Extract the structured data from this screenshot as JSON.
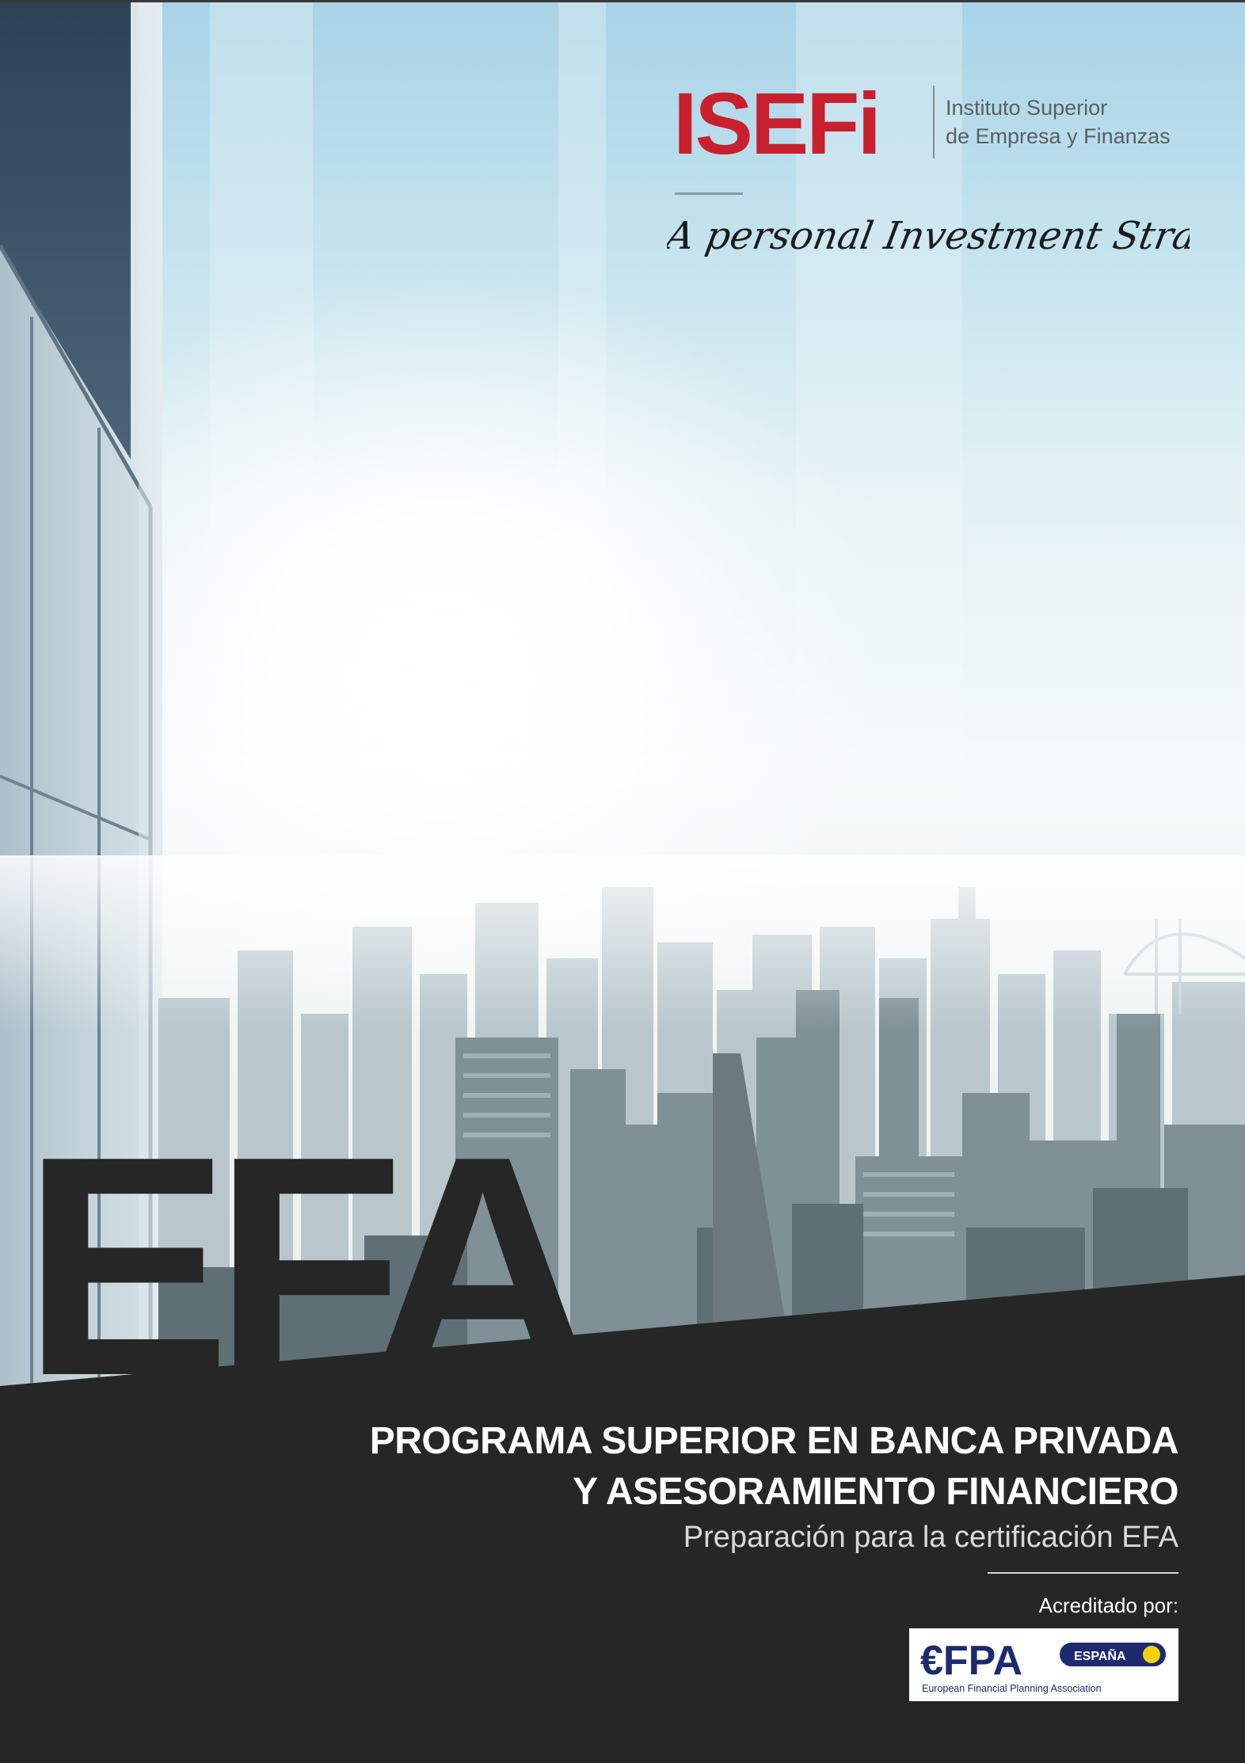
{
  "logo": {
    "name": "ISEFi",
    "subtitle_line1": "Instituto Superior",
    "subtitle_line2": "de Empresa y Finanzas",
    "brand_color": "#c8202f"
  },
  "tagline": "A personal Investment Strategy",
  "hero": {
    "big_text": "EFA"
  },
  "program": {
    "title_line1": "PROGRAMA SUPERIOR EN BANCA PRIVADA",
    "title_line2": "Y ASESORAMIENTO FINANCIERO",
    "subtitle": "Preparación para la certificación EFA"
  },
  "accreditation": {
    "label": "Acreditado por:",
    "badge": {
      "acronym": "€FPA",
      "country": "ESPAÑA",
      "full_name": "European Financial Planning Association",
      "navy": "#1d2b6e",
      "yellow": "#f5d10a"
    }
  },
  "colors": {
    "dark_band": "#262626",
    "sky_top": "#a8d3e6"
  }
}
